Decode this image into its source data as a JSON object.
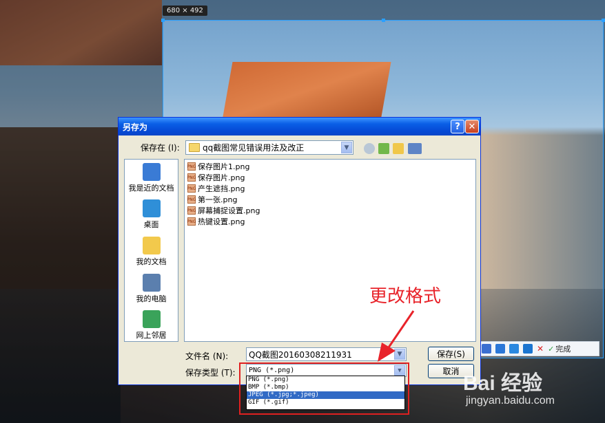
{
  "capture": {
    "size_label": "680 × 492",
    "toolbar_done": "完成"
  },
  "dialog": {
    "title": "另存为",
    "help_glyph": "?",
    "close_glyph": "✕",
    "save_in_label": "保存在 (I):",
    "save_in_value": "qq截图常见错误用法及改正",
    "places": [
      {
        "label": "我是近的文档",
        "icon": "recent-docs-icon",
        "color": "#3a7bd5"
      },
      {
        "label": "桌面",
        "icon": "desktop-icon",
        "color": "#2f8fd8"
      },
      {
        "label": "我的文档",
        "icon": "my-documents-icon",
        "color": "#f2c94c"
      },
      {
        "label": "我的电脑",
        "icon": "my-computer-icon",
        "color": "#5b7fae"
      },
      {
        "label": "网上邻居",
        "icon": "network-icon",
        "color": "#3aa35a"
      }
    ],
    "files": [
      "保存图片1.png",
      "保存图片.png",
      "产生遮挡.png",
      "第一张.png",
      "屏幕捕捉设置.png",
      "热键设置.png"
    ],
    "png_badge": "PNG",
    "filename_label": "文件名 (N):",
    "filename_value": "QQ截图20160308211931",
    "filetype_label": "保存类型 (T):",
    "filetype_value": "PNG (*.png)",
    "save_button": "保存(S)",
    "cancel_button": "取消",
    "filetype_options": [
      "PNG (*.png)",
      "BMP (*.bmp)",
      "JPEG (*.jpg;*.jpeg)",
      "GIF (*.gif)"
    ],
    "selected_option_index": 2
  },
  "annotation": {
    "text": "更改格式",
    "color": "#e8232a"
  },
  "watermark": {
    "brand": "Bai 经验",
    "url": "jingyan.baidu.com"
  }
}
